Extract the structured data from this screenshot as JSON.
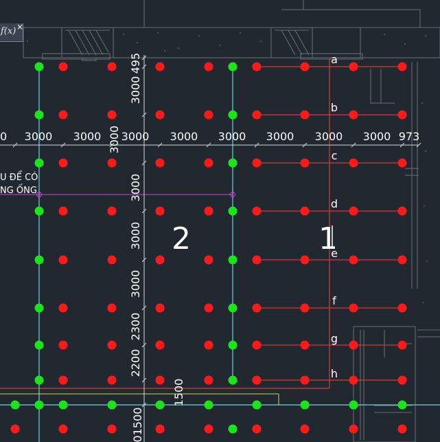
{
  "command_panel": {
    "fx_label": "f(x)",
    "close_symbol": "×"
  },
  "dimensions": {
    "horizontal": [
      "0",
      "3000",
      "3000",
      "3000",
      "3000",
      "3000",
      "3000",
      "3000",
      "3000",
      "973"
    ],
    "vertical": [
      "495",
      "3000",
      "3000",
      "3000",
      "3000",
      "3000",
      "2300",
      "2200",
      "1500",
      "01500"
    ]
  },
  "row_labels": [
    "a",
    "b",
    "c",
    "d",
    "e",
    "f",
    "g",
    "h"
  ],
  "zones": [
    "2",
    "1"
  ],
  "note_lines": [
    "U ĐỂ CÓ",
    "NG ỐNG"
  ],
  "colors": {
    "background": "#212830",
    "red_head": "#ff1a1a",
    "green_head": "#19e619",
    "cyan_line": "#6fd3e0",
    "magenta_line": "#d33fd3",
    "red_line": "#ff3b3b",
    "yellow_line": "#d8d83a"
  }
}
